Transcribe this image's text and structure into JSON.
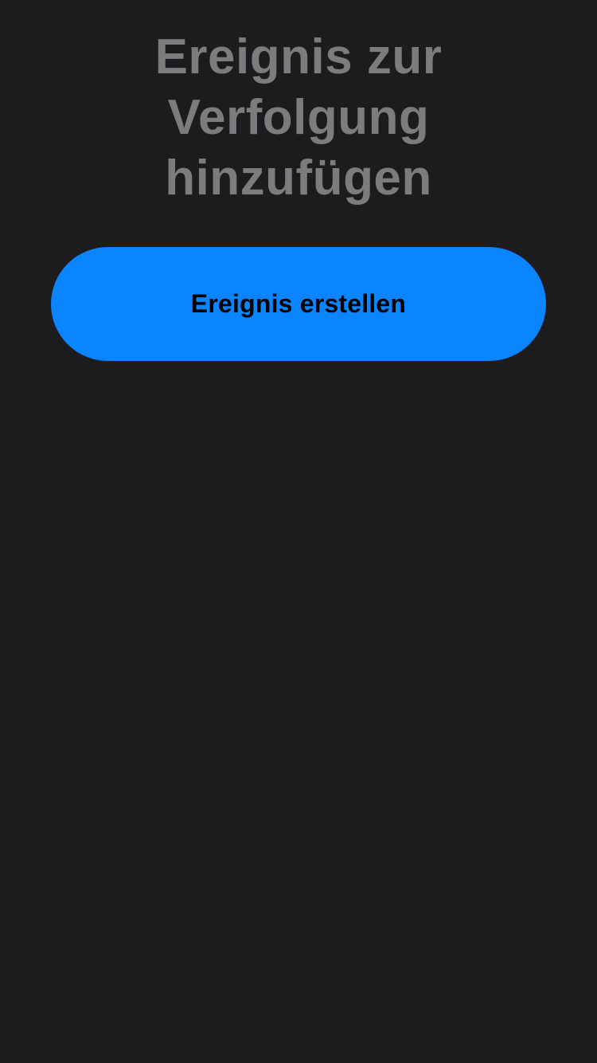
{
  "screen": {
    "title": "Ereignis zur Verfolgung hinzufügen",
    "primary_button_label": "Ereignis erstellen"
  },
  "colors": {
    "background": "#1c1c1e",
    "title_text": "#7c7c7f",
    "accent": "#0a84ff",
    "button_text": "#000000"
  }
}
